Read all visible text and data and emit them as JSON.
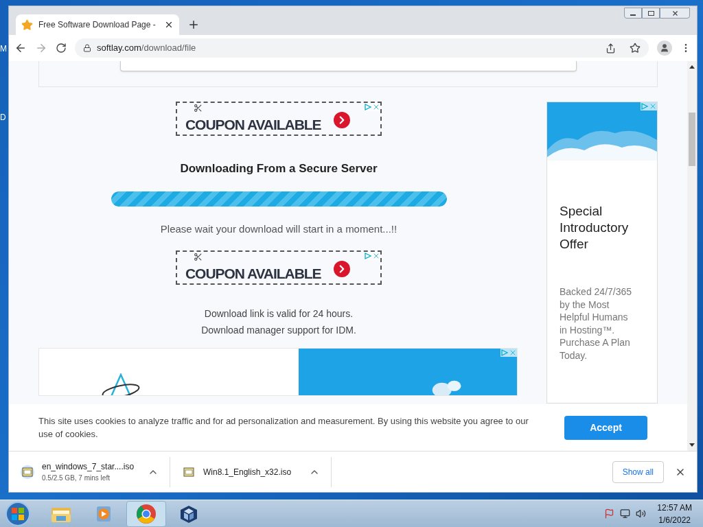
{
  "desktop": {
    "icon_labels": [
      "M",
      "D"
    ]
  },
  "browser": {
    "tabs": [
      {
        "title": "Free Software Download Page -",
        "selected": true
      }
    ],
    "url": {
      "domain": "softlay.com",
      "path": "/download/file"
    }
  },
  "page": {
    "top_ad": {
      "badge": "COUPON AVAILABLE"
    },
    "heading": "Downloading From a Secure Server",
    "progress": {
      "level": 1
    },
    "wait_text": "Please wait your download will start in a moment...!!",
    "bottom_ad": {
      "badge": "COUPON AVAILABLE"
    },
    "notes": [
      "Download link is valid for 24 hours.",
      "Download manager support for IDM."
    ],
    "side_ad": {
      "title": "Special Introductory Offer",
      "body": "Backed 24/7/365 by the Most Helpful Humans in Hosting™. Purchase A Plan Today."
    }
  },
  "cookie_banner": {
    "text": "This site uses cookies to analyze traffic and for ad personalization and measurement. By using this website you agree to our use of cookies.",
    "button": "Accept"
  },
  "downloads": {
    "items": [
      {
        "name": "en_windows_7_star....iso",
        "status": "0.5/2.5 GB, 7 mins left"
      },
      {
        "name": "Win8.1_English_x32.iso"
      }
    ],
    "show_all": "Show all"
  },
  "taskbar": {
    "apps": [
      {
        "kind": "folder",
        "selected": false
      },
      {
        "kind": "media",
        "selected": false
      },
      {
        "kind": "chrome",
        "selected": true
      },
      {
        "kind": "box",
        "selected": false
      }
    ],
    "time": "12:57 AM",
    "date": "1/6/2022"
  }
}
